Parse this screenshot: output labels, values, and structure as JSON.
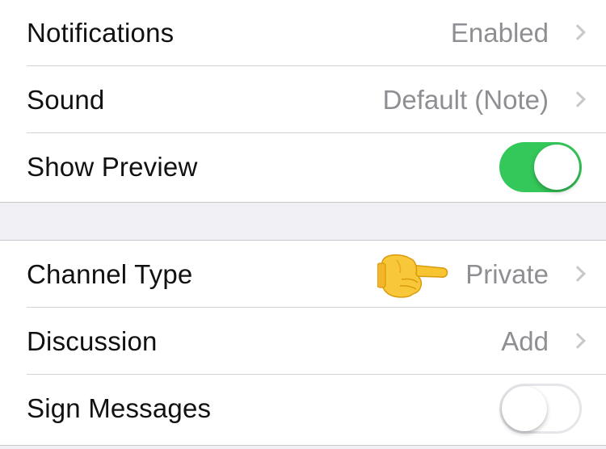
{
  "settings": {
    "notifications": {
      "label": "Notifications",
      "value": "Enabled"
    },
    "sound": {
      "label": "Sound",
      "value": "Default (Note)"
    },
    "show_preview": {
      "label": "Show Preview",
      "enabled": true
    },
    "channel_type": {
      "label": "Channel Type",
      "value": "Private"
    },
    "discussion": {
      "label": "Discussion",
      "value": "Add"
    },
    "sign_messages": {
      "label": "Sign Messages",
      "enabled": false
    }
  },
  "colors": {
    "toggle_on": "#34c759",
    "background": "#efeff4",
    "secondary_text": "#8e8e93"
  },
  "icons": {
    "pointer": "backhand-index-pointing-right-emoji",
    "chevron": "chevron-right-icon"
  }
}
